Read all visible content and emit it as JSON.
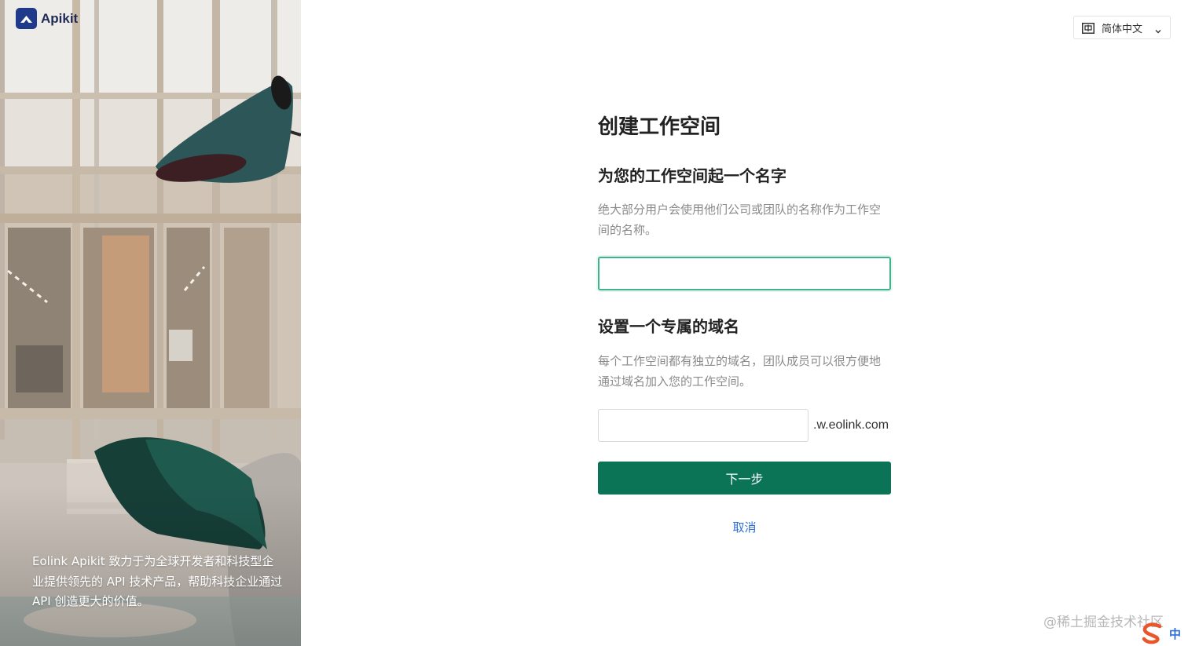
{
  "brand": {
    "name": "Apikit",
    "tagline": "Eolink Apikit 致力于为全球开发者和科技型企业提供领先的 API 技术产品，帮助科技企业通过 API 创造更大的价值。"
  },
  "language": {
    "selected": "简体中文",
    "icon": "translate-icon"
  },
  "form": {
    "title": "创建工作空间",
    "name_section": {
      "title": "为您的工作空间起一个名字",
      "description": "绝大部分用户会使用他们公司或团队的名称作为工作空间的名称。",
      "input_value": "",
      "input_placeholder": ""
    },
    "domain_section": {
      "title": "设置一个专属的域名",
      "description": "每个工作空间都有独立的域名，团队成员可以很方便地通过域名加入您的工作空间。",
      "input_value": "",
      "suffix": ".w.eolink.com"
    },
    "next_label": "下一步",
    "cancel_label": "取消"
  },
  "watermark": "@稀土掘金技术社区",
  "ime": {
    "mode": "中"
  },
  "colors": {
    "primary": "#0c7456",
    "focus_border": "#3fb38d",
    "link": "#2f6fd6",
    "brand": "#1f3a8a"
  }
}
